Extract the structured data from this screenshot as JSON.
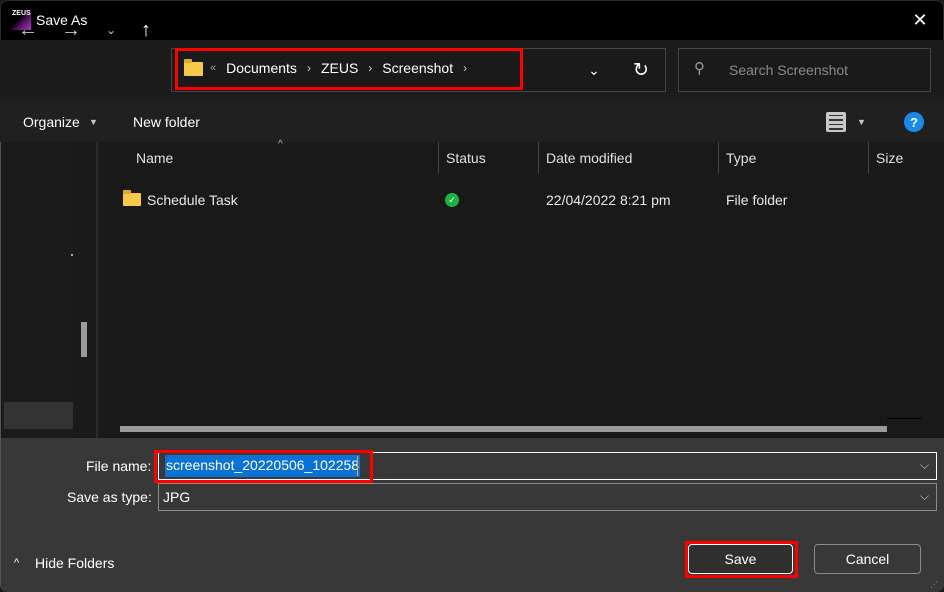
{
  "window": {
    "app_logo_text": "ZEUS",
    "title": "Save As",
    "close_glyph": "✕"
  },
  "navigation": {
    "back_glyph": "←",
    "forward_glyph": "→",
    "recent_glyph": "⌄",
    "up_glyph": "↑",
    "overflow_glyph": "«",
    "breadcrumbs": [
      "Documents",
      "ZEUS",
      "Screenshot"
    ],
    "separator_glyph": "›",
    "dropdown_glyph": "⌄",
    "refresh_glyph": "↻"
  },
  "search": {
    "icon_glyph": "⚲",
    "placeholder": "Search Screenshot"
  },
  "toolbar": {
    "organize_label": "Organize",
    "organize_arrow": "▼",
    "new_folder_label": "New folder",
    "view_arrow": "▼",
    "help_label": "?"
  },
  "file_list": {
    "sort_glyph": "^",
    "columns": [
      "Name",
      "Status",
      "Date modified",
      "Type",
      "Size"
    ],
    "rows": [
      {
        "name": "Schedule Task",
        "status_glyph": "✓",
        "date_modified": "22/04/2022 8:21 pm",
        "type": "File folder",
        "size": ""
      }
    ]
  },
  "form": {
    "file_name_label": "File name:",
    "file_name_value": "screenshot_20220506_102258",
    "save_as_type_label": "Save as type:",
    "save_as_type_value": "JPG",
    "chevron_glyph": "⌵"
  },
  "footer": {
    "hide_folders_icon": "^",
    "hide_folders_label": "Hide Folders",
    "save_label": "Save",
    "cancel_label": "Cancel"
  },
  "colors": {
    "highlight_annotation": "#ff0000",
    "selection": "#0a72d4",
    "status_ok": "#1fb141",
    "help_blue": "#1a8ae8"
  }
}
